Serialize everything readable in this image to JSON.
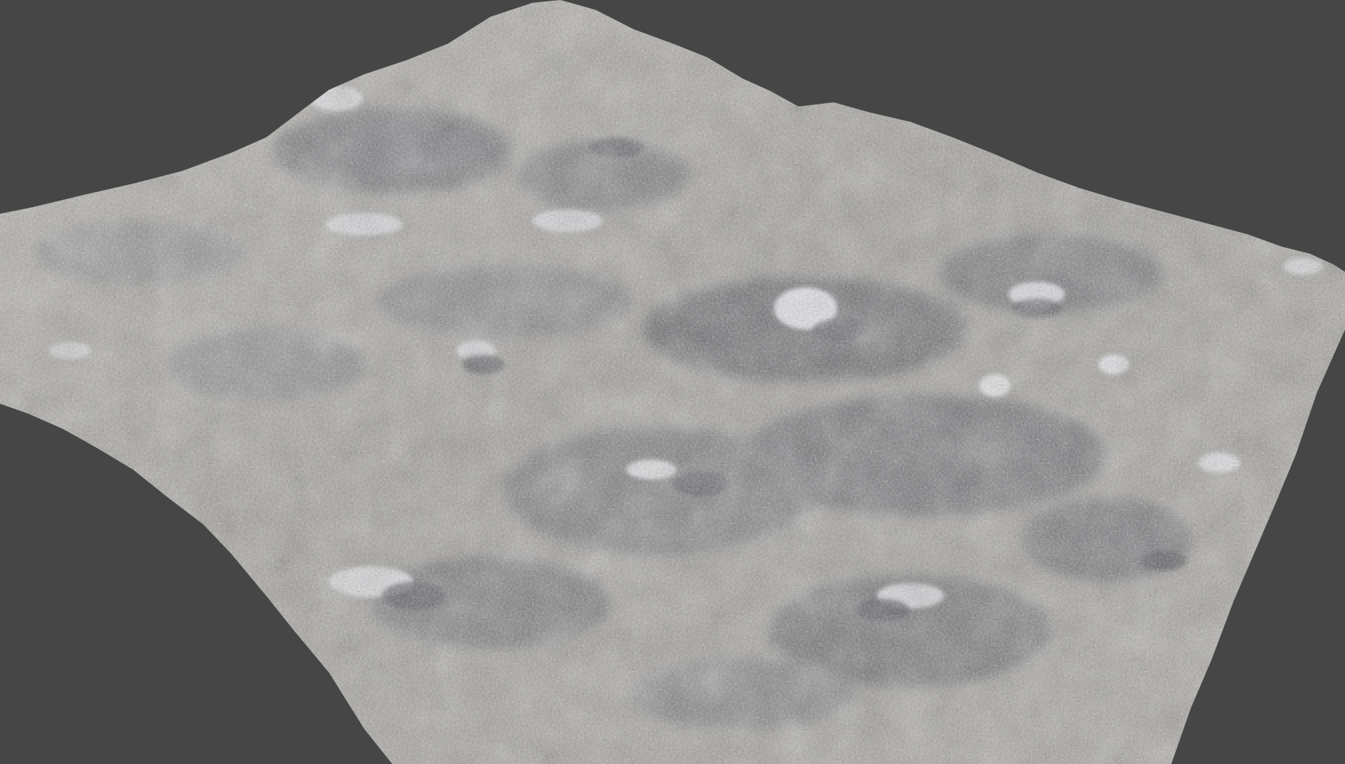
{
  "scene": {
    "subject": "terrain-mesh",
    "colors": {
      "background": "#464646",
      "surface_base": "#a29f9a",
      "surface_light": "#d9d7d4",
      "surface_shadow": "#55565c",
      "rock_highlight": "#eeeef2"
    }
  }
}
